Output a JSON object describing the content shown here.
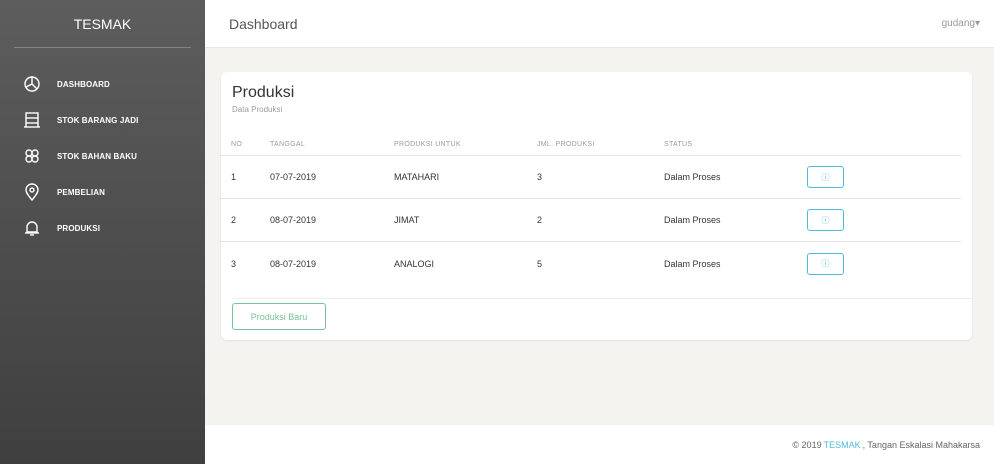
{
  "sidebar": {
    "brand": "TESMAK",
    "items": [
      {
        "label": "DASHBOARD",
        "icon": "dashboard-icon"
      },
      {
        "label": "STOK BARANG JADI",
        "icon": "archive-icon"
      },
      {
        "label": "STOK BAHAN BAKU",
        "icon": "cogs-icon"
      },
      {
        "label": "PEMBELIAN",
        "icon": "location-pin-icon"
      },
      {
        "label": "PRODUKSI",
        "icon": "bell-icon"
      }
    ]
  },
  "header": {
    "title": "Dashboard",
    "user": "gudang",
    "user_caret": "▾"
  },
  "card": {
    "title": "Produksi",
    "subtitle": "Data Produksi",
    "columns": [
      "NO",
      "TANGGAL",
      "PRODUKSI UNTUK",
      "JML. PRODUKSI",
      "STATUS"
    ],
    "rows": [
      {
        "no": "1",
        "tanggal": "07-07-2019",
        "untuk": "MATAHARI",
        "jml": "3",
        "status": "Dalam Proses"
      },
      {
        "no": "2",
        "tanggal": "08-07-2019",
        "untuk": "JIMAT",
        "jml": "2",
        "status": "Dalam Proses"
      },
      {
        "no": "3",
        "tanggal": "08-07-2019",
        "untuk": "ANALOGI",
        "jml": "5",
        "status": "Dalam Proses"
      }
    ],
    "detail_icon": "ⓘ",
    "new_button": "Produksi Baru"
  },
  "footer": {
    "prefix": "© 2019",
    "brand": "TESMAK",
    "suffix": ", Tangan Eskalasi Mahakarsa"
  },
  "colors": {
    "accent_info": "#51bcda",
    "accent_success": "#7ac29a",
    "sidebar_dark": "#3f3f3f"
  }
}
